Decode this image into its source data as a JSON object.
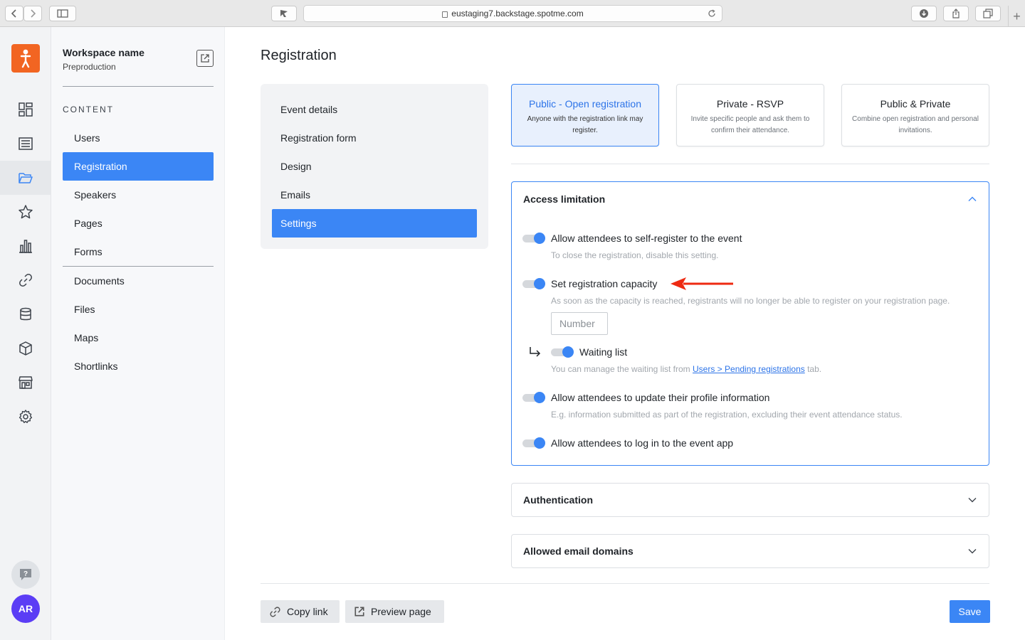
{
  "browser": {
    "url": "eustaging7.backstage.spotme.com"
  },
  "workspace": {
    "name": "Workspace name",
    "env": "Preproduction"
  },
  "sidebar": {
    "heading": "CONTENT",
    "items": [
      "Users",
      "Registration",
      "Speakers",
      "Pages",
      "Forms",
      "Documents",
      "Files",
      "Maps",
      "Shortlinks"
    ],
    "active": "Registration"
  },
  "user": {
    "initials": "AR"
  },
  "page": {
    "title": "Registration"
  },
  "subnav": {
    "items": [
      "Event details",
      "Registration form",
      "Design",
      "Emails",
      "Settings"
    ],
    "active": "Settings"
  },
  "modes": [
    {
      "title": "Public - Open registration",
      "desc": "Anyone with the registration link may register.",
      "selected": true
    },
    {
      "title": "Private - RSVP",
      "desc": "Invite specific people and ask them to confirm their attendance.",
      "selected": false
    },
    {
      "title": "Public & Private",
      "desc": "Combine open registration and personal invitations.",
      "selected": false
    }
  ],
  "access": {
    "title": "Access limitation",
    "self_register": {
      "label": "Allow attendees to self-register to the event",
      "help": "To close the registration, disable this setting.",
      "on": true
    },
    "capacity": {
      "label": "Set registration capacity",
      "help": "As soon as the capacity is reached, registrants will no longer be able to register on your registration page.",
      "placeholder": "Number",
      "on": true
    },
    "waiting": {
      "label": "Waiting list",
      "help_prefix": "You can manage the waiting list from ",
      "help_link": "Users > Pending registrations",
      "help_suffix": " tab.",
      "on": true
    },
    "update_profile": {
      "label": "Allow attendees to update their profile information",
      "help": "E.g. information submitted as part of the registration, excluding their event attendance status.",
      "on": true
    },
    "login": {
      "label": "Allow attendees to log in to the event app",
      "on": true
    }
  },
  "authentication": {
    "title": "Authentication"
  },
  "email_domains": {
    "title": "Allowed email domains"
  },
  "footer": {
    "copy_link": "Copy link",
    "preview": "Preview page",
    "save": "Save"
  },
  "colors": {
    "accent": "#3b86f5",
    "brand": "#f26522",
    "avatar": "#5b3df5",
    "annotation_arrow": "#ee2a12"
  }
}
